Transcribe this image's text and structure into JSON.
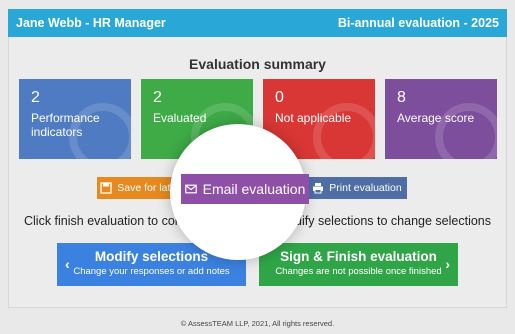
{
  "header": {
    "user_title": "Jane Webb - HR Manager",
    "evaluation_title": "Bi-annual evaluation - 2025"
  },
  "summary": {
    "title": "Evaluation summary",
    "cards": [
      {
        "value": "2",
        "label": "Performance indicators",
        "color": "#4e7bc2"
      },
      {
        "value": "2",
        "label": "Evaluated",
        "color": "#3eab47"
      },
      {
        "value": "0",
        "label": "Not applicable",
        "color": "#d93735"
      },
      {
        "value": "8",
        "label": "Average score",
        "color": "#7d4e9c"
      }
    ]
  },
  "actions": {
    "save_label": "Save for later",
    "email_label": "Email evaluation",
    "print_label": "Print evaluation"
  },
  "instructions": {
    "left_text": "Click finish evaluation to complet",
    "right_text": "modify selections to change selections"
  },
  "buttons": {
    "modify_title": "Modify selections",
    "modify_subtitle": "Change your responses or add notes",
    "finish_title": "Sign & Finish evaluation",
    "finish_subtitle": "Changes are not possible once finished"
  },
  "footer": {
    "copyright": "© AssessTEAM LLP, 2021, All rights reserved."
  }
}
